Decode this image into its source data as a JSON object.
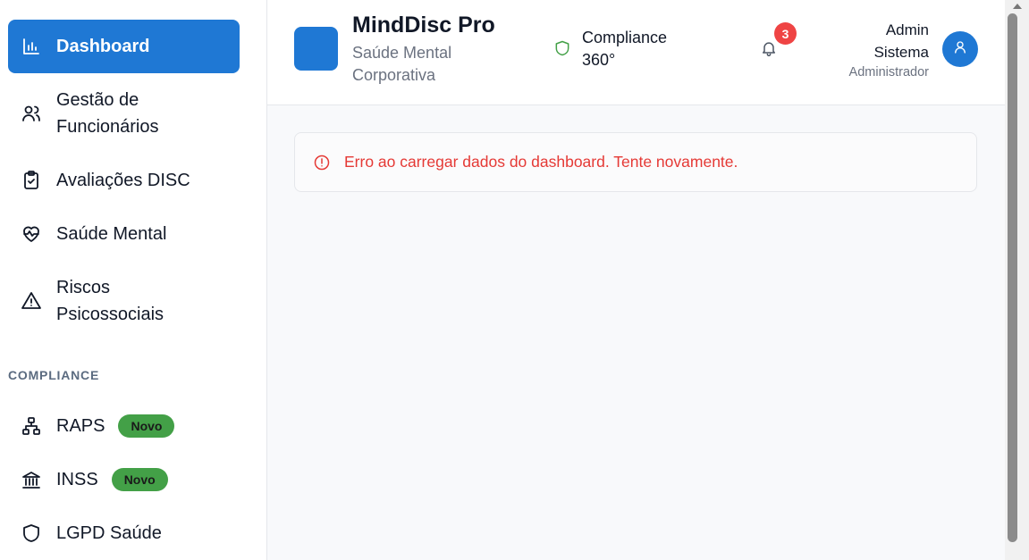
{
  "sidebar": {
    "items": [
      {
        "label": "Dashboard",
        "icon": "bar-chart-icon",
        "active": true
      },
      {
        "label": "Gestão de Funcionários",
        "icon": "users-icon"
      },
      {
        "label": "Avaliações DISC",
        "icon": "clipboard-check-icon"
      },
      {
        "label": "Saúde Mental",
        "icon": "heart-pulse-icon"
      },
      {
        "label": "Riscos Psicossociais",
        "icon": "alert-triangle-icon"
      }
    ],
    "section_title": "COMPLIANCE",
    "compliance_items": [
      {
        "label": "RAPS",
        "icon": "network-icon",
        "badge": "Novo"
      },
      {
        "label": "INSS",
        "icon": "bank-icon",
        "badge": "Novo"
      },
      {
        "label": "LGPD Saúde",
        "icon": "shield-icon"
      }
    ]
  },
  "header": {
    "brand_title": "MindDisc Pro",
    "brand_subtitle": "Saúde Mental Corporativa",
    "compliance_label": "Compliance 360°",
    "notification_count": "3",
    "user_name": "Admin Sistema",
    "user_role": "Administrador"
  },
  "main": {
    "error_message": "Erro ao carregar dados do dashboard. Tente novamente."
  },
  "colors": {
    "accent": "#1f78d4",
    "success": "#43a047",
    "error": "#e53935",
    "badge_red": "#ef4444"
  }
}
